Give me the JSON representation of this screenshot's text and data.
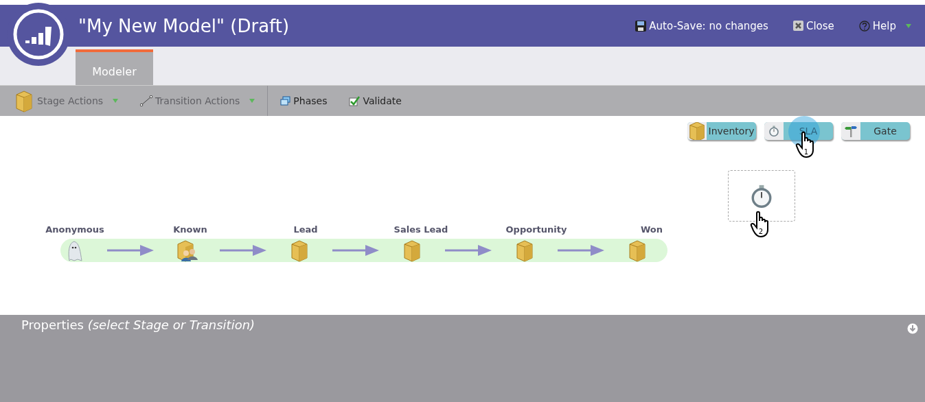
{
  "window": {
    "title": "\"My New Model\" (Draft)"
  },
  "header_actions": [
    {
      "kind": "save",
      "label": "Auto-Save: no changes",
      "dropdown": false
    },
    {
      "kind": "close",
      "label": "Close",
      "dropdown": false
    },
    {
      "kind": "help",
      "label": "Help",
      "dropdown": true
    }
  ],
  "tabs": [
    {
      "label": "Modeler",
      "selected": true
    }
  ],
  "toolbar": [
    {
      "kind": "stage",
      "label": "Stage Actions",
      "dropdown": true,
      "disabled": true
    },
    {
      "kind": "transition",
      "label": "Transition Actions",
      "dropdown": true,
      "disabled": true
    },
    {
      "kind": "phases",
      "label": "Phases",
      "dropdown": false,
      "disabled": false
    },
    {
      "kind": "validate",
      "label": "Validate",
      "dropdown": false,
      "disabled": false
    }
  ],
  "palette": [
    {
      "kind": "inventory",
      "label": "Inventory"
    },
    {
      "kind": "sla",
      "label": "SLA"
    },
    {
      "kind": "gate",
      "label": "Gate"
    }
  ],
  "stages": [
    {
      "name": "Anonymous",
      "kind": "ghost"
    },
    {
      "name": "Known",
      "kind": "people"
    },
    {
      "name": "Lead",
      "kind": "box"
    },
    {
      "name": "Sales Lead",
      "kind": "box"
    },
    {
      "name": "Opportunity",
      "kind": "box"
    },
    {
      "name": "Won",
      "kind": "box"
    }
  ],
  "cursors": [
    "1",
    "2"
  ],
  "properties": {
    "title": "Properties *(select Stage or Transition)*"
  }
}
